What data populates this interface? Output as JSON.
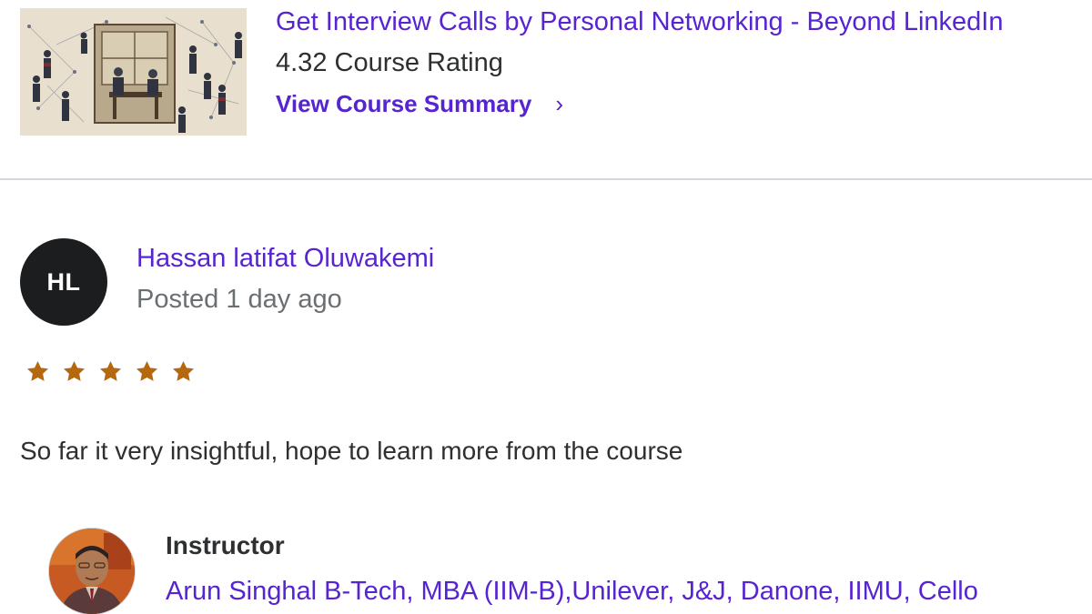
{
  "course": {
    "title": "Get Interview Calls by Personal Networking - Beyond LinkedIn",
    "rating_text": "4.32 Course Rating",
    "summary_link": "View Course Summary",
    "thumbnail_icon": "networking-illustration"
  },
  "review": {
    "initials": "HL",
    "reviewer_name": "Hassan latifat Oluwakemi",
    "posted": "Posted 1 day ago",
    "rating": 5,
    "rating_max": 5,
    "text": "So far it very insightful, hope to learn more from the course",
    "star_color": "#b4690e"
  },
  "instructor": {
    "heading": "Instructor",
    "name": "Arun Singhal B-Tech, MBA (IIM-B),Unilever, J&J, Danone, IIMU, Cello"
  },
  "colors": {
    "link": "#5624d0",
    "text": "#2d2f31",
    "muted": "#6a6f73",
    "avatar_bg": "#1c1d1f",
    "divider": "#d1d7dc"
  }
}
